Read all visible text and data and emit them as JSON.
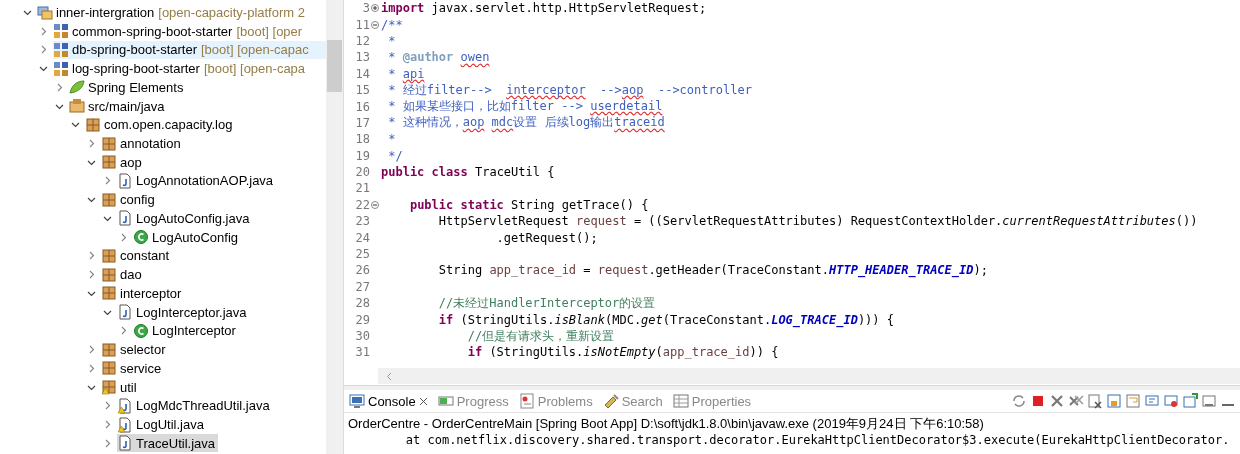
{
  "tree": [
    {
      "label": "inner-intergration",
      "decoration": "[open-capacity-platform 2",
      "kind": "working-set",
      "expanded": true,
      "selected": false,
      "hovered": false,
      "children": [
        {
          "label": "common-spring-boot-starter",
          "decoration": "[boot] [oper",
          "kind": "project",
          "expanded": false,
          "selected": false,
          "hovered": false
        },
        {
          "label": "db-spring-boot-starter",
          "decoration": "[boot] [open-capac",
          "kind": "project",
          "expanded": false,
          "selected": false,
          "hovered": true
        },
        {
          "label": "log-spring-boot-starter",
          "decoration": "[boot] [open-capa",
          "kind": "project",
          "expanded": true,
          "selected": false,
          "hovered": false,
          "children": [
            {
              "label": "Spring Elements",
              "kind": "spring",
              "expanded": false,
              "selected": false,
              "hovered": false
            },
            {
              "label": "src/main/java",
              "kind": "source",
              "expanded": true,
              "selected": false,
              "hovered": false,
              "children": [
                {
                  "label": "com.open.capacity.log",
                  "kind": "package",
                  "expanded": true,
                  "selected": false,
                  "hovered": false,
                  "children": [
                    {
                      "label": "annotation",
                      "kind": "package",
                      "expanded": false,
                      "selected": false,
                      "hovered": false
                    },
                    {
                      "label": "aop",
                      "kind": "package",
                      "expanded": true,
                      "selected": false,
                      "hovered": false,
                      "children": [
                        {
                          "label": "LogAnnotationAOP.java",
                          "kind": "file",
                          "expanded": false,
                          "selected": false,
                          "hovered": false
                        }
                      ]
                    },
                    {
                      "label": "config",
                      "kind": "package",
                      "expanded": true,
                      "selected": false,
                      "hovered": false,
                      "children": [
                        {
                          "label": "LogAutoConfig.java",
                          "kind": "file",
                          "expanded": true,
                          "selected": false,
                          "hovered": false,
                          "children": [
                            {
                              "label": "LogAutoConfig",
                              "kind": "class",
                              "expanded": false,
                              "selected": false,
                              "hovered": false
                            }
                          ]
                        }
                      ]
                    },
                    {
                      "label": "constant",
                      "kind": "package",
                      "expanded": false,
                      "selected": false,
                      "hovered": false
                    },
                    {
                      "label": "dao",
                      "kind": "package",
                      "expanded": false,
                      "selected": false,
                      "hovered": false
                    },
                    {
                      "label": "interceptor",
                      "kind": "package",
                      "expanded": true,
                      "selected": false,
                      "hovered": false,
                      "children": [
                        {
                          "label": "LogInterceptor.java",
                          "kind": "file",
                          "expanded": true,
                          "selected": false,
                          "hovered": false,
                          "children": [
                            {
                              "label": "LogInterceptor",
                              "kind": "class",
                              "expanded": false,
                              "selected": false,
                              "hovered": false
                            }
                          ]
                        }
                      ]
                    },
                    {
                      "label": "selector",
                      "kind": "package",
                      "expanded": false,
                      "selected": false,
                      "hovered": false
                    },
                    {
                      "label": "service",
                      "kind": "package",
                      "expanded": false,
                      "selected": false,
                      "hovered": false
                    },
                    {
                      "label": "util",
                      "kind": "package-warning",
                      "expanded": true,
                      "selected": false,
                      "hovered": false,
                      "children": [
                        {
                          "label": "LogMdcThreadUtil.java",
                          "kind": "file-warning",
                          "expanded": false,
                          "selected": false,
                          "hovered": false
                        },
                        {
                          "label": "LogUtil.java",
                          "kind": "file-warning",
                          "expanded": false,
                          "selected": false,
                          "hovered": false
                        },
                        {
                          "label": "TraceUtil.java",
                          "kind": "file",
                          "expanded": false,
                          "selected": true,
                          "hovered": false
                        }
                      ]
                    }
                  ]
                }
              ]
            }
          ]
        }
      ]
    }
  ],
  "editor": {
    "lines": [
      {
        "number": "3",
        "fold": {
          "collapsed": true
        },
        "segments": [
          {
            "kind": "keyword",
            "text": "import"
          },
          {
            "kind": "text",
            "text": " javax.servlet.http.HttpServletRequest;"
          }
        ]
      },
      {
        "number": "11",
        "fold": {
          "collapsed": false
        },
        "segments": [
          {
            "kind": "doc",
            "text": "/**"
          }
        ]
      },
      {
        "number": "12",
        "segments": [
          {
            "kind": "doc",
            "text": " *"
          }
        ]
      },
      {
        "number": "13",
        "segments": [
          {
            "kind": "doc",
            "text": " * "
          },
          {
            "kind": "doctag",
            "text": "@author "
          },
          {
            "kind": "doc-typo",
            "text": "owen"
          }
        ]
      },
      {
        "number": "14",
        "segments": [
          {
            "kind": "doc",
            "text": " * "
          },
          {
            "kind": "doc-typo",
            "text": "api"
          }
        ]
      },
      {
        "number": "15",
        "segments": [
          {
            "kind": "doc",
            "text": " * 经过filter-->  "
          },
          {
            "kind": "doc-typo",
            "text": "interceptor"
          },
          {
            "kind": "doc",
            "text": "  -->"
          },
          {
            "kind": "doc-typo",
            "text": "aop"
          },
          {
            "kind": "doc",
            "text": "  -->controller"
          }
        ]
      },
      {
        "number": "16",
        "segments": [
          {
            "kind": "doc",
            "text": " * 如果某些接口，比如filter --> "
          },
          {
            "kind": "doc-typo",
            "text": "userdetail"
          }
        ]
      },
      {
        "number": "17",
        "segments": [
          {
            "kind": "doc",
            "text": " * 这种情况，"
          },
          {
            "kind": "doc-typo",
            "text": "aop "
          },
          {
            "kind": "doc-typo",
            "text": "mdc"
          },
          {
            "kind": "doc",
            "text": "设置 后续log输出"
          },
          {
            "kind": "doc-typo",
            "text": "traceid"
          }
        ]
      },
      {
        "number": "18",
        "segments": [
          {
            "kind": "doc",
            "text": " *"
          }
        ]
      },
      {
        "number": "19",
        "segments": [
          {
            "kind": "doc",
            "text": " */"
          }
        ]
      },
      {
        "number": "20",
        "segments": [
          {
            "kind": "keyword",
            "text": "public "
          },
          {
            "kind": "keyword",
            "text": "class"
          },
          {
            "kind": "text",
            "text": " TraceUtil {"
          }
        ]
      },
      {
        "number": "21"
      },
      {
        "number": "22",
        "fold": {
          "collapsed": false
        },
        "segments": [
          {
            "kind": "keyword",
            "text": "    public "
          },
          {
            "kind": "keyword",
            "text": "static"
          },
          {
            "kind": "text",
            "text": " String getTrace() {"
          }
        ]
      },
      {
        "number": "23",
        "segments": [
          {
            "kind": "text",
            "text": "        HttpServletRequest "
          },
          {
            "kind": "variable",
            "text": "request"
          },
          {
            "kind": "text",
            "text": " = ((ServletRequestAttributes) RequestContextHolder."
          },
          {
            "kind": "static",
            "text": "currentRequestAttributes"
          },
          {
            "kind": "text",
            "text": "())"
          }
        ]
      },
      {
        "number": "24",
        "segments": [
          {
            "kind": "text",
            "text": "                .getRequest();"
          }
        ]
      },
      {
        "number": "25"
      },
      {
        "number": "26",
        "segments": [
          {
            "kind": "text",
            "text": "        String "
          },
          {
            "kind": "variable",
            "text": "app_trace_id"
          },
          {
            "kind": "text",
            "text": " = "
          },
          {
            "kind": "variable",
            "text": "request"
          },
          {
            "kind": "text",
            "text": ".getHeader(TraceConstant."
          },
          {
            "kind": "constant",
            "text": "HTTP_HEADER_TRACE_ID"
          },
          {
            "kind": "text",
            "text": ");"
          }
        ]
      },
      {
        "number": "27"
      },
      {
        "number": "28",
        "segments": [
          {
            "kind": "comment",
            "text": "        //未经过HandlerInterceptor的设置"
          }
        ]
      },
      {
        "number": "29",
        "segments": [
          {
            "kind": "keyword",
            "text": "        if"
          },
          {
            "kind": "text",
            "text": " (StringUtils."
          },
          {
            "kind": "static",
            "text": "isBlank"
          },
          {
            "kind": "text",
            "text": "(MDC."
          },
          {
            "kind": "static",
            "text": "get"
          },
          {
            "kind": "text",
            "text": "(TraceConstant."
          },
          {
            "kind": "constant",
            "text": "LOG_TRACE_ID"
          },
          {
            "kind": "text",
            "text": "))) {"
          }
        ]
      },
      {
        "number": "30",
        "segments": [
          {
            "kind": "comment",
            "text": "            //但是有请求头，重新设置"
          }
        ]
      },
      {
        "number": "31",
        "segments": [
          {
            "kind": "keyword",
            "text": "            if"
          },
          {
            "kind": "text",
            "text": " (StringUtils."
          },
          {
            "kind": "static",
            "text": "isNotEmpty"
          },
          {
            "kind": "text",
            "text": "("
          },
          {
            "kind": "variable",
            "text": "app_trace_id"
          },
          {
            "kind": "text",
            "text": ")) {"
          }
        ]
      }
    ]
  },
  "console": {
    "tabs": [
      {
        "label": "Console",
        "selected": true,
        "closable": true
      },
      {
        "label": "Progress",
        "selected": false,
        "closable": false
      },
      {
        "label": "Problems",
        "selected": false,
        "closable": false
      },
      {
        "label": "Search",
        "selected": false,
        "closable": false
      },
      {
        "label": "Properties",
        "selected": false,
        "closable": false
      }
    ],
    "header": "OrderCentre - OrderCentreMain [Spring Boot App] D:\\soft\\jdk1.8.0\\bin\\javaw.exe (2019年9月24日 下午6:10:58)",
    "output": [
      "\tat com.netflix.discovery.shared.transport.decorator.EurekaHttpClientDecorator$3.execute(EurekaHttpClientDecorator."
    ]
  }
}
